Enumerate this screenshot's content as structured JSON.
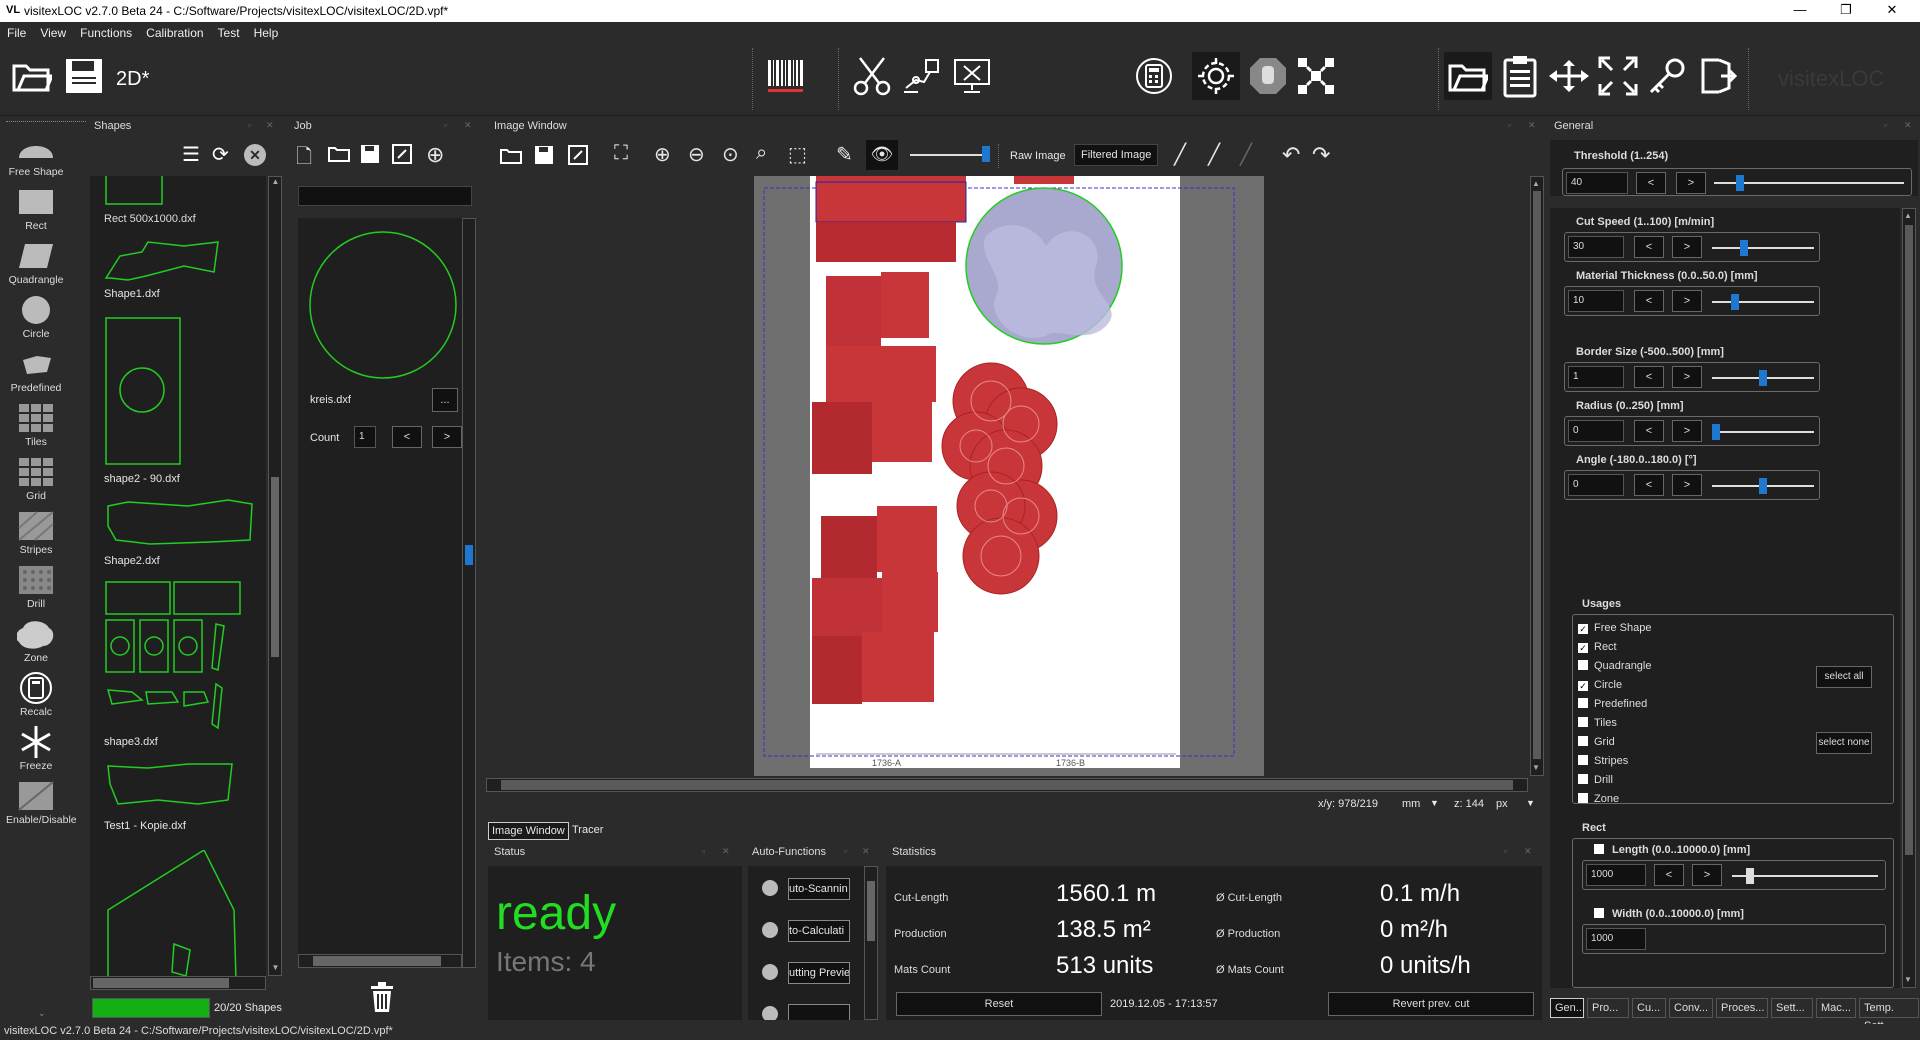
{
  "app": {
    "title": "visitexLOC v2.7.0 Beta 24 - C:/Software/Projects/visitexLOC/visitexLOC/2D.vpf*",
    "logo_text": "VL",
    "brand": "visitexLOC",
    "file_label": "2D*",
    "status_path": "visitexLOC v2.7.0 Beta 24 - C:/Software/Projects/visitexLOC/visitexLOC/2D.vpf*"
  },
  "window_controls": {
    "minimize": "—",
    "maximize": "❐",
    "close": "✕"
  },
  "menu": [
    "File",
    "View",
    "Functions",
    "Calibration",
    "Test",
    "Help"
  ],
  "shape_tools": [
    {
      "label": "Free Shape",
      "icon": "free-shape-icon"
    },
    {
      "label": "Rect",
      "icon": "rect-icon"
    },
    {
      "label": "Quadrangle",
      "icon": "quadrangle-icon"
    },
    {
      "label": "Circle",
      "icon": "circle-icon"
    },
    {
      "label": "Predefined",
      "icon": "predefined-icon"
    },
    {
      "label": "Tiles",
      "icon": "tiles-icon"
    },
    {
      "label": "Grid",
      "icon": "grid-icon"
    },
    {
      "label": "Stripes",
      "icon": "stripes-icon"
    },
    {
      "label": "Drill",
      "icon": "drill-icon"
    },
    {
      "label": "Zone",
      "icon": "zone-icon"
    },
    {
      "label": "Recalc",
      "icon": "recalc-icon"
    },
    {
      "label": "Freeze",
      "icon": "freeze-icon"
    },
    {
      "label": "Enable/Disable",
      "icon": "enable-disable-icon"
    }
  ],
  "shapes_panel": {
    "title": "Shapes",
    "items": [
      "Rect 500x1000.dxf",
      "Shape1.dxf",
      "shape2 - 90.dxf",
      "Shape2.dxf",
      "shape3.dxf",
      "Test1 - Kopie.dxf"
    ],
    "progress_text": "20/20 Shapes",
    "progress": 1.0
  },
  "job_panel": {
    "title": "Job",
    "file": "kreis.dxf",
    "more_label": "...",
    "count_label": "Count",
    "count_value": "1",
    "prev": "<",
    "next": ">"
  },
  "image_window": {
    "title": "Image Window",
    "raw_image": "Raw Image",
    "filtered_image": "Filtered Image",
    "xy_label": "x/y: 978/219",
    "unit": "mm",
    "zoom_label": "z: 144",
    "zoom_unit": "px",
    "ruler_a": "1736-A",
    "ruler_b": "1736-B",
    "slider_value": 0.95,
    "tabs": [
      "Image Window",
      "Tracer"
    ]
  },
  "status_panel": {
    "title": "Status",
    "state": "ready",
    "items": "Items: 4"
  },
  "auto_functions": {
    "title": "Auto-Functions",
    "items": [
      "uto-Scannin",
      "to-Calculati",
      "utting Previe"
    ]
  },
  "statistics": {
    "title": "Statistics",
    "rows": [
      {
        "label": "Cut-Length",
        "value": "1560.1 m",
        "avg_label": "Ø Cut-Length",
        "avg_value": "0.1 m/h"
      },
      {
        "label": "Production",
        "value": "138.5 m²",
        "avg_label": "Ø Production",
        "avg_value": "0 m²/h"
      },
      {
        "label": "Mats Count",
        "value": "513 units",
        "avg_label": "Ø Mats Count",
        "avg_value": "0 units/h"
      }
    ],
    "reset": "Reset",
    "timestamp": "2019.12.05 - 17:13:57",
    "revert": "Revert prev. cut"
  },
  "general": {
    "title": "General",
    "threshold": {
      "label": "Threshold (1..254)",
      "value": "40",
      "level": 0.12
    },
    "cut_speed": {
      "label": "Cut Speed (1..100) [m/min]",
      "value": "30",
      "level": 0.3
    },
    "thickness": {
      "label": "Material Thickness (0.0..50.0) [mm]",
      "value": "10",
      "level": 0.2
    },
    "border": {
      "label": "Border Size (-500..500) [mm]",
      "value": "1",
      "level": 0.5
    },
    "radius": {
      "label": "Radius (0..250) [mm]",
      "value": "0",
      "level": 0.0
    },
    "angle": {
      "label": "Angle (-180.0..180.0) [°]",
      "value": "0",
      "level": 0.5
    },
    "usages_title": "Usages",
    "usages": [
      {
        "label": "Free Shape",
        "checked": true
      },
      {
        "label": "Rect",
        "checked": true
      },
      {
        "label": "Quadrangle",
        "checked": false
      },
      {
        "label": "Circle",
        "checked": true
      },
      {
        "label": "Predefined",
        "checked": false
      },
      {
        "label": "Tiles",
        "checked": false
      },
      {
        "label": "Grid",
        "checked": false
      },
      {
        "label": "Stripes",
        "checked": false
      },
      {
        "label": "Drill",
        "checked": false
      },
      {
        "label": "Zone",
        "checked": false
      }
    ],
    "select_all": "select all",
    "select_none": "select none",
    "rect_title": "Rect",
    "length": {
      "label": "Length (0.0..10000.0) [mm]",
      "value": "1000",
      "level": 0.1
    },
    "width": {
      "label": "Width (0.0..10000.0) [mm]",
      "value": "1000"
    },
    "prev": "<",
    "next": ">",
    "tabs": [
      "Gen...",
      "Pro...",
      "Cu...",
      "Conv...",
      "Proces...",
      "Sett...",
      "Mac...",
      "Temp. Sett..."
    ]
  },
  "colors": {
    "ready": "#22dd22",
    "accent": "#1e78d0",
    "cut_red": "#c8363a",
    "cut_circle": "#a9a9cf"
  }
}
